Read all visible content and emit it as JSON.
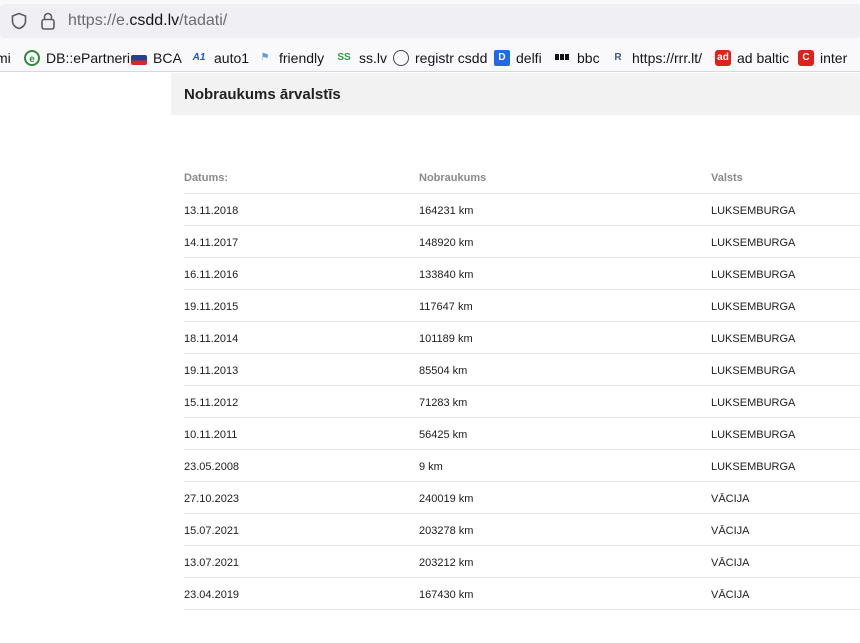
{
  "browser": {
    "url_prefix": "https://e.",
    "url_host": "csdd.lv",
    "url_path": "/tadati/"
  },
  "bookmarks": [
    {
      "label": "mi",
      "icon": "none"
    },
    {
      "label": "DB::ePartneri",
      "icon": "dbepartneri-icon"
    },
    {
      "label": "BCA",
      "icon": "bca-icon"
    },
    {
      "label": "auto1",
      "icon": "auto1-icon"
    },
    {
      "label": "friendly",
      "icon": "friendly-icon"
    },
    {
      "label": "ss.lv",
      "icon": "ss-icon"
    },
    {
      "label": "registr csdd",
      "icon": "globe-icon"
    },
    {
      "label": "delfi",
      "icon": "delfi-icon"
    },
    {
      "label": "bbc",
      "icon": "bbc-icon"
    },
    {
      "label": "https://rrr.lt/",
      "icon": "rrr-icon"
    },
    {
      "label": "ad baltic",
      "icon": "adbaltic-icon"
    },
    {
      "label": "inter",
      "icon": "inter-icon"
    }
  ],
  "page": {
    "title": "Nobraukums ārvalstīs"
  },
  "table": {
    "headers": {
      "date": "Datums:",
      "mileage": "Nobraukums",
      "country": "Valsts"
    },
    "rows": [
      {
        "date": "13.11.2018",
        "mileage": "164231 km",
        "country": "LUKSEMBURGA"
      },
      {
        "date": "14.11.2017",
        "mileage": "148920 km",
        "country": "LUKSEMBURGA"
      },
      {
        "date": "16.11.2016",
        "mileage": "133840 km",
        "country": "LUKSEMBURGA"
      },
      {
        "date": "19.11.2015",
        "mileage": "117647 km",
        "country": "LUKSEMBURGA"
      },
      {
        "date": "18.11.2014",
        "mileage": "101189 km",
        "country": "LUKSEMBURGA"
      },
      {
        "date": "19.11.2013",
        "mileage": "85504 km",
        "country": "LUKSEMBURGA"
      },
      {
        "date": "15.11.2012",
        "mileage": "71283 km",
        "country": "LUKSEMBURGA"
      },
      {
        "date": "10.11.2011",
        "mileage": "56425 km",
        "country": "LUKSEMBURGA"
      },
      {
        "date": "23.05.2008",
        "mileage": "9 km",
        "country": "LUKSEMBURGA"
      },
      {
        "date": "27.10.2023",
        "mileage": "240019 km",
        "country": "VĀCIJA"
      },
      {
        "date": "15.07.2021",
        "mileage": "203278 km",
        "country": "VĀCIJA"
      },
      {
        "date": "13.07.2021",
        "mileage": "203212 km",
        "country": "VĀCIJA"
      },
      {
        "date": "23.04.2019",
        "mileage": "167430 km",
        "country": "VĀCIJA"
      }
    ]
  }
}
